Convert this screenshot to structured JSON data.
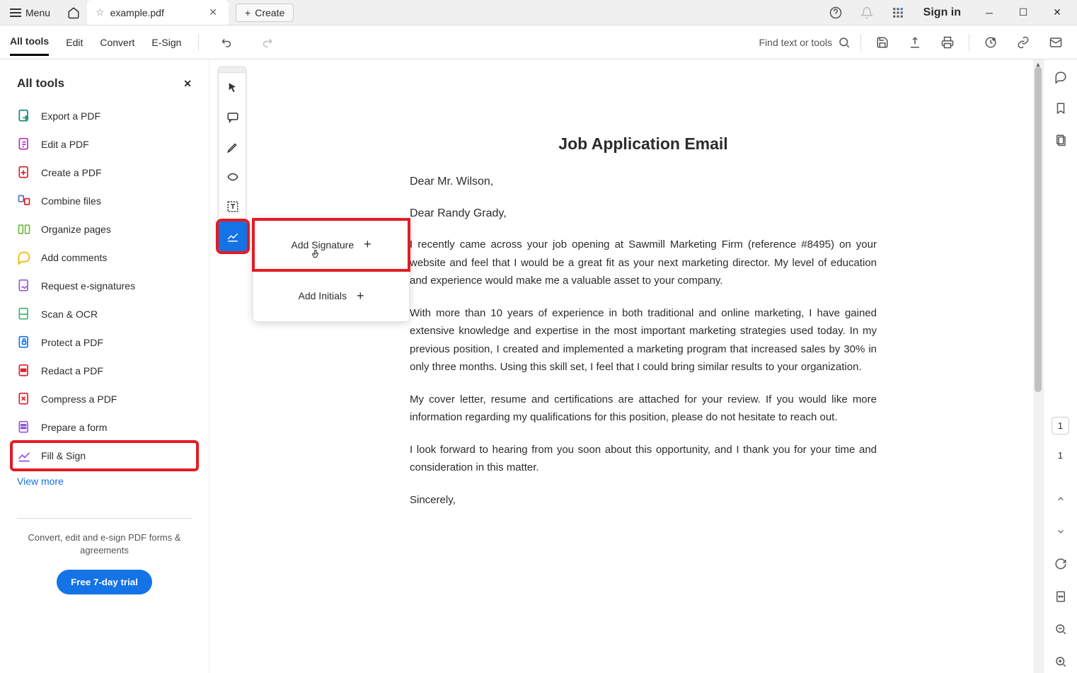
{
  "titlebar": {
    "menu_label": "Menu",
    "tab_filename": "example.pdf",
    "create_label": "Create",
    "signin_label": "Sign in"
  },
  "toolbar": {
    "all_tools": "All tools",
    "edit": "Edit",
    "convert": "Convert",
    "esign": "E-Sign",
    "find_placeholder": "Find text or tools"
  },
  "left_panel": {
    "title": "All tools",
    "tools": [
      "Export a PDF",
      "Edit a PDF",
      "Create a PDF",
      "Combine files",
      "Organize pages",
      "Add comments",
      "Request e-signatures",
      "Scan & OCR",
      "Protect a PDF",
      "Redact a PDF",
      "Compress a PDF",
      "Prepare a form",
      "Fill & Sign"
    ],
    "view_more": "View more",
    "footer_text": "Convert, edit and e-sign PDF forms & agreements",
    "trial_btn": "Free 7-day trial"
  },
  "sig_popup": {
    "add_signature": "Add Signature",
    "add_initials": "Add Initials"
  },
  "document": {
    "title": "Job Application Email",
    "greet1": "Dear Mr. Wilson,",
    "greet2": "Dear Randy Grady,",
    "p1": "I recently came across your job opening at Sawmill Marketing Firm (reference #8495) on your website and feel that I would be a great fit as your next marketing director. My level of education and experience would make me a valuable asset to your company.",
    "p2": "With more than 10 years of experience in both traditional and online marketing, I have gained extensive knowledge and expertise in the most important marketing strategies used today. In my previous position, I created and implemented a marketing program that increased sales by 30% in only three months. Using this skill set, I feel that I could bring similar results to your organization.",
    "p3": "My cover letter, resume and certifications are attached for your review. If you would like more information regarding my qualifications for this position, please do not hesitate to reach out.",
    "p4": "I look forward to hearing from you soon about this opportunity, and I thank you for your time and consideration in this matter.",
    "signoff": "Sincerely,"
  },
  "pager": {
    "current": "1",
    "total": "1"
  },
  "colors": {
    "accent": "#1473e6",
    "highlight": "#e31b23"
  }
}
